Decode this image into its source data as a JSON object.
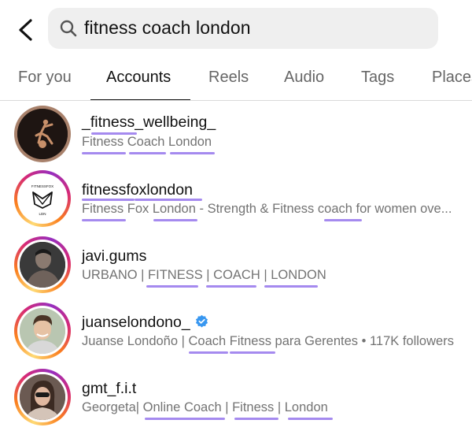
{
  "search": {
    "query": "fitness coach london"
  },
  "tabs": [
    "For you",
    "Accounts",
    "Reels",
    "Audio",
    "Tags",
    "Places"
  ],
  "active_tab": "Accounts",
  "results": [
    {
      "username": "_fitness_wellbeing_",
      "subtitle": "Fitness Coach London",
      "verified": false,
      "ring": "none"
    },
    {
      "username": "fitnessfoxlondon",
      "subtitle": "Fitness Fox London - Strength & Fitness coach for women ove...",
      "verified": false,
      "ring": "story",
      "avatar_text": [
        "FITNESSFOX",
        "LDN"
      ]
    },
    {
      "username": "javi.gums",
      "subtitle": "URBANO | FITNESS | COACH | LONDON",
      "verified": false,
      "ring": "story"
    },
    {
      "username": "juanselondono_",
      "subtitle": "Juanse Londoño | Coach Fitness para Gerentes • 117K followers",
      "verified": true,
      "ring": "story"
    },
    {
      "username": "gmt_f.i.t",
      "subtitle": "Georgeta| Online Coach | Fitness | London",
      "verified": false,
      "ring": "story"
    }
  ],
  "colors": {
    "highlight": "#a58aef",
    "verified": "#3897f0",
    "tab_active": "#111111",
    "tab_inactive": "#666666"
  }
}
